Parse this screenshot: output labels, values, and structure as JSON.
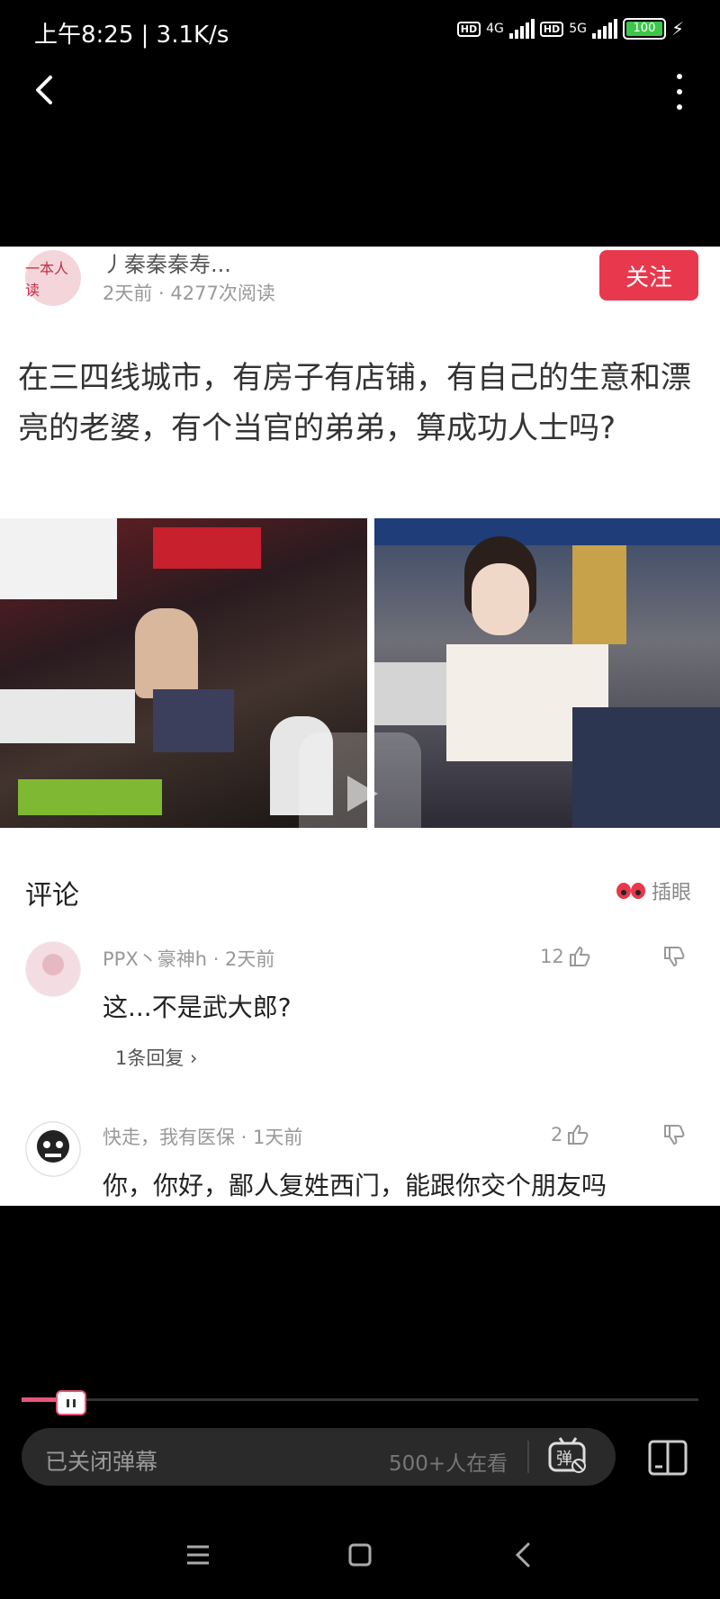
{
  "status_bar": {
    "time_speed": "上午8:25 | 3.1K/s",
    "net1": "4G",
    "net2": "5G",
    "hd": "HD",
    "battery": "100"
  },
  "post": {
    "author": "丿秦秦秦寿...",
    "avatar_text": "一本人读",
    "meta": "2天前 · 4277次阅读",
    "follow_label": "关注",
    "question": "在三四线城市，有房子有店铺，有自己的生意和漂亮的老婆，有个当官的弟弟，算成功人士吗?"
  },
  "comments_section": {
    "title": "评论",
    "eye_label": "插眼",
    "comments": [
      {
        "name": "PPX丶豪神h · 2天前",
        "text": "这...不是武大郎?",
        "likes": "12",
        "replies": "1条回复 ›"
      },
      {
        "name": "快走，我有医保 · 1天前",
        "text": "你，你好，鄙人复姓西门，能跟你交个朋友吗",
        "likes": "2"
      }
    ]
  },
  "player": {
    "progress_fraction": 0.07,
    "danmaku_label": "已关闭弹幕",
    "viewers": "500+人在看",
    "danmaku_icon_text": "弹"
  },
  "colors": {
    "accent": "#e8567a",
    "follow": "#e8384d",
    "background": "#000000"
  }
}
